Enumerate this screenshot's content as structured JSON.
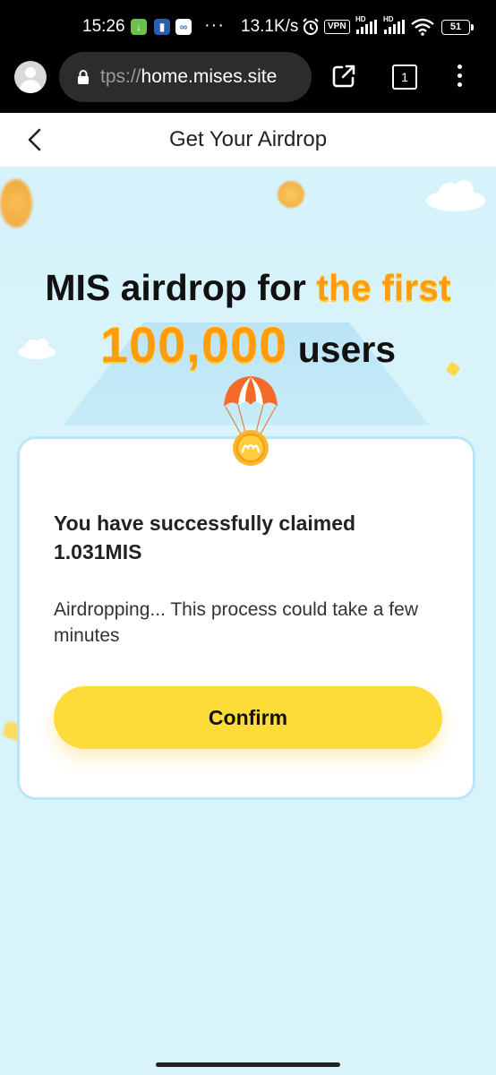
{
  "status_bar": {
    "time": "15:26",
    "network_speed": "13.1K/s",
    "vpn_label": "VPN",
    "signal_label": "HD",
    "battery_level": "51",
    "more_indicator": "···"
  },
  "browser": {
    "url_scheme": "tps://",
    "url_host": "home.mises.site",
    "tab_count": "1"
  },
  "header": {
    "title": "Get Your Airdrop"
  },
  "hero": {
    "line1_prefix": "MIS airdrop for ",
    "line1_highlight": "the first",
    "line2_highlight": "100,000",
    "line2_suffix": " users"
  },
  "card": {
    "title": "You have successfully claimed 1.031MIS",
    "message": "Airdropping... This process could take a few minutes",
    "confirm_label": "Confirm"
  },
  "colors": {
    "accent_yellow": "#fddc3a",
    "highlight_orange": "#ff9c0f",
    "page_background": "#d8f3f9"
  }
}
